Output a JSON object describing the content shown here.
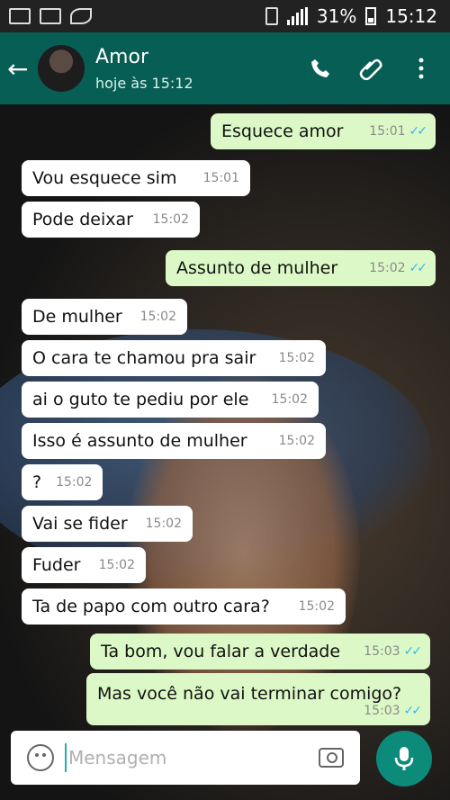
{
  "status_bar": {
    "battery": "31%",
    "time": "15:12"
  },
  "header": {
    "contact_name": "Amor",
    "last_seen": "hoje às 15:12",
    "icons": [
      "back-arrow-icon",
      "call-icon",
      "attach-icon",
      "more-icon"
    ]
  },
  "messages": [
    {
      "dir": "out",
      "text": "Esquece amor",
      "time": "15:01",
      "read": true
    },
    {
      "dir": "in",
      "text": "Vou esquece sim",
      "time": "15:01"
    },
    {
      "dir": "in",
      "text": "Pode deixar",
      "time": "15:02"
    },
    {
      "dir": "out",
      "text": "Assunto de mulher",
      "time": "15:02",
      "read": true
    },
    {
      "dir": "in",
      "text": "De mulher",
      "time": "15:02"
    },
    {
      "dir": "in",
      "text": "O cara te chamou pra sair",
      "time": "15:02"
    },
    {
      "dir": "in",
      "text": "ai o guto te pediu por ele",
      "time": "15:02"
    },
    {
      "dir": "in",
      "text": "Isso é assunto de mulher",
      "time": "15:02"
    },
    {
      "dir": "in",
      "text": "?",
      "time": "15:02"
    },
    {
      "dir": "in",
      "text": "Vai se fider",
      "time": "15:02"
    },
    {
      "dir": "in",
      "text": "Fuder",
      "time": "15:02"
    },
    {
      "dir": "in",
      "text": "Ta de papo com outro cara?",
      "time": "15:02"
    },
    {
      "dir": "out",
      "text": "Ta bom, vou falar a verdade",
      "time": "15:03",
      "read": true
    },
    {
      "dir": "out",
      "text": "Mas você não vai terminar comigo?",
      "time": "15:03",
      "read": true
    }
  ],
  "input": {
    "placeholder": "Mensagem"
  },
  "colors": {
    "header": "#075e54",
    "outgoing": "#dcf8c6",
    "incoming": "#ffffff",
    "tick": "#34b7f1",
    "mic": "#0c8a7a"
  }
}
